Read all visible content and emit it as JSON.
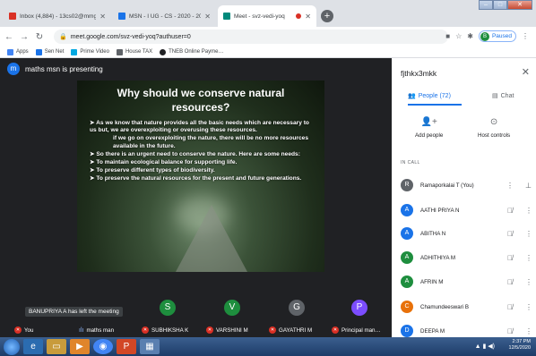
{
  "browser": {
    "tabs": [
      {
        "title": "Inbox (4,884) - 13cs02@mmgm…",
        "favcolor": "#d93025"
      },
      {
        "title": "MSN - I UG - CS - 2020 - 2023",
        "favcolor": "#1a73e8"
      },
      {
        "title": "Meet - svz-vedi-yoq",
        "favcolor": "#00897b"
      }
    ],
    "new_tab": "+",
    "url": "meet.google.com/svz-vedi-yoq?authuser=0",
    "profile_initial": "B",
    "profile_label": "Paused",
    "bookmarks": [
      {
        "label": "Apps",
        "color": "#4285f4"
      },
      {
        "label": "Sen Net",
        "color": "#1a73e8"
      },
      {
        "label": "Prime Video",
        "color": "#00a8e1"
      },
      {
        "label": "House TAX",
        "color": "#5f6368"
      },
      {
        "label": "TNEB Online Payme…",
        "color": "#202124"
      }
    ]
  },
  "meet": {
    "presenter_initial": "m",
    "presenter_text": "maths msn is presenting",
    "slide": {
      "title_line1": "Why should we conserve natural",
      "title_line2": "resources?",
      "b1": "➤ As we know that nature provides all the basic needs which are necessary to us but, we are overexploiting or overusing these resources.",
      "b1_cont": "if we go on overexploiting the nature, there will be no more resources available in the future.",
      "b2": "➤ So there is an urgent need to conserve the nature. Here are some needs:",
      "b3": "➤ To maintain ecological balance for supporting life.",
      "b4": "➤ To preserve different types of biodiversity.",
      "b5": "➤ To preserve the natural resources for the present and future generations."
    },
    "tiles": [
      {
        "initial": "S",
        "color": "#1e8e3e"
      },
      {
        "initial": "V",
        "color": "#1e8e3e"
      },
      {
        "initial": "G",
        "color": "#5f6368"
      },
      {
        "initial": "P",
        "color": "#7c4dff"
      }
    ],
    "toast": "BANUPRIYA A has left the meeting",
    "names": [
      "You",
      "maths man",
      "SUBHIKSHA K",
      "VARSHINI M",
      "GAYATHRI M",
      "Principal man…"
    ]
  },
  "panel": {
    "code": "fjthkx3mkk",
    "people_tab": "People (72)",
    "chat_tab": "Chat",
    "add_people": "Add people",
    "host_controls": "Host controls",
    "in_call": "IN CALL",
    "participants": [
      {
        "initial": "R",
        "name": "Ramaporkalai T (You)",
        "color": "#5f6368"
      },
      {
        "initial": "A",
        "name": "AATHI PRIYA N",
        "color": "#1a73e8"
      },
      {
        "initial": "A",
        "name": "ABITHA N",
        "color": "#1a73e8"
      },
      {
        "initial": "A",
        "name": "ADHITHIYA M",
        "color": "#1e8e3e"
      },
      {
        "initial": "A",
        "name": "AFRIN M",
        "color": "#1e8e3e"
      },
      {
        "initial": "C",
        "name": "Chamundeeswari B",
        "color": "#e8710a"
      },
      {
        "initial": "D",
        "name": "DEEPA M",
        "color": "#1a73e8"
      }
    ]
  },
  "taskbar": {
    "time": "2:37 PM",
    "date": "12/5/2020"
  }
}
